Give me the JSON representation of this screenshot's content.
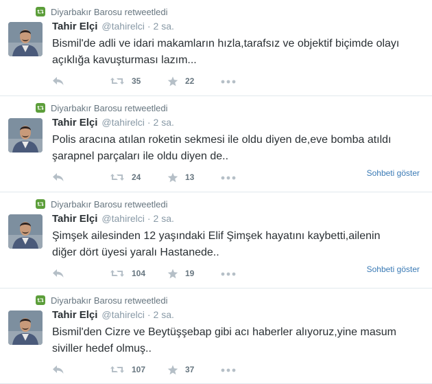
{
  "tweets": [
    {
      "retweeted_by": "Diyarbakır Barosu retweetledi",
      "name": "Tahir Elçi",
      "handle": "@tahirelci",
      "sep": "·",
      "time": "2 sa.",
      "line1": "Bismil'de adli ve idari makamların hızla,tarafsız ve objektif biçimde olayı",
      "line2": "açıklığa kavuşturması lazım...",
      "retweets": "35",
      "favorites": "22",
      "conversation": ""
    },
    {
      "retweeted_by": "Diyarbakır Barosu retweetledi",
      "name": "Tahir Elçi",
      "handle": "@tahirelci",
      "sep": "·",
      "time": "2 sa.",
      "line1": "Polis aracına atılan roketin sekmesi ile oldu diyen de,eve bomba atıldı",
      "line2": "şarapnel parçaları ile oldu diyen de..",
      "retweets": "24",
      "favorites": "13",
      "conversation": "Sohbeti göster"
    },
    {
      "retweeted_by": "Diyarbakır Barosu retweetledi",
      "name": "Tahir Elçi",
      "handle": "@tahirelci",
      "sep": "·",
      "time": "2 sa.",
      "line1": "Şimşek ailesinden 12 yaşındaki Elif Şimşek hayatını kaybetti,ailenin",
      "line2": "diğer dört üyesi yaralı Hastanede..",
      "retweets": "104",
      "favorites": "19",
      "conversation": "Sohbeti göster"
    },
    {
      "retweeted_by": "Diyarbakır Barosu retweetledi",
      "name": "Tahir Elçi",
      "handle": "@tahirelci",
      "sep": "·",
      "time": "2 sa.",
      "line1": "Bismil'den Cizre ve Beytüşşebap gibi acı haberler alıyoruz,yine masum",
      "line2": "siviller hedef olmuş..",
      "retweets": "107",
      "favorites": "37",
      "conversation": ""
    }
  ]
}
